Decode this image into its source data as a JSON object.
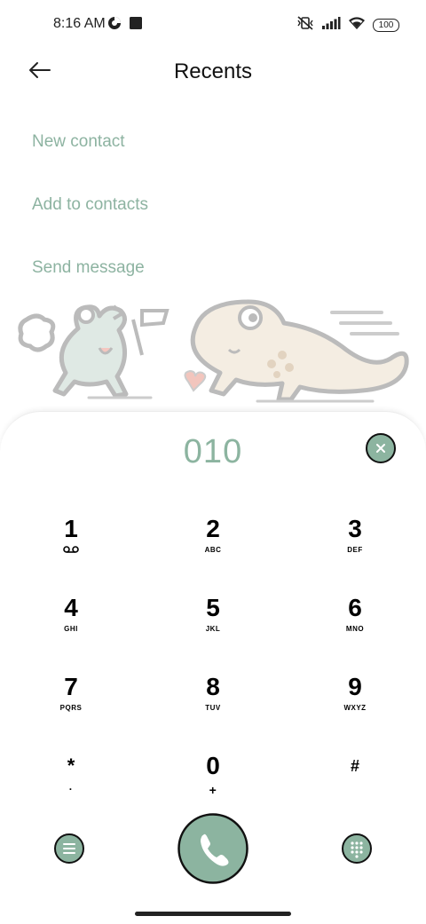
{
  "status_bar": {
    "time": "8:16 AM",
    "battery": "100",
    "left_icons": [
      "data-saver-icon",
      "square-notification-icon"
    ],
    "right_icons": [
      "vibrate-off-icon",
      "signal-icon",
      "wifi-icon",
      "battery-icon"
    ]
  },
  "header": {
    "title": "Recents",
    "back_icon": "back-arrow-icon"
  },
  "actions": [
    {
      "label": "New contact"
    },
    {
      "label": "Add to contacts"
    },
    {
      "label": "Send message"
    }
  ],
  "dialer": {
    "number": "010",
    "clear_icon": "clear-icon",
    "keys": [
      {
        "digit": "1",
        "letters": "voicemail"
      },
      {
        "digit": "2",
        "letters": "ABC"
      },
      {
        "digit": "3",
        "letters": "DEF"
      },
      {
        "digit": "4",
        "letters": "GHI"
      },
      {
        "digit": "5",
        "letters": "JKL"
      },
      {
        "digit": "6",
        "letters": "MNO"
      },
      {
        "digit": "7",
        "letters": "PQRS"
      },
      {
        "digit": "8",
        "letters": "TUV"
      },
      {
        "digit": "9",
        "letters": "WXYZ"
      },
      {
        "digit": "*",
        "letters": "·"
      },
      {
        "digit": "0",
        "letters": "+"
      },
      {
        "digit": "#",
        "letters": ""
      }
    ],
    "bottom": {
      "menu_icon": "menu-icon",
      "call_icon": "phone-icon",
      "keypad_icon": "keypad-icon"
    }
  },
  "colors": {
    "accent": "#8cb4a0",
    "accent_dark": "#111111"
  }
}
